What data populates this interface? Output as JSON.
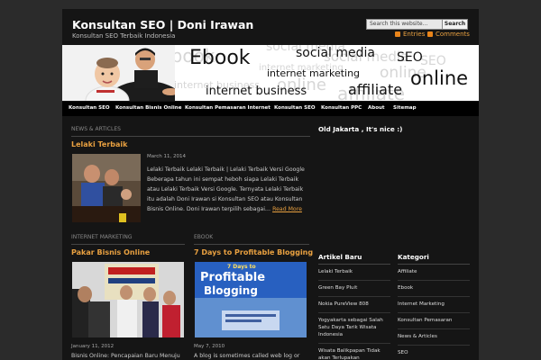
{
  "header": {
    "site_title": "Konsultan SEO | Doni Irawan",
    "tagline": "Konsultan SEO Terbaik Indonesia",
    "search_placeholder": "Search this website...",
    "search_button": "Search",
    "feed_entries": "Entries",
    "feed_comments": "Comments"
  },
  "banner": {
    "keywords": [
      "Ebook",
      "social media",
      "SEO",
      "internet marketing",
      "online",
      "internet business",
      "affiliate"
    ],
    "ghost_words": [
      "Ebook",
      "social media",
      "social media",
      "internet marketing",
      "online",
      "online",
      "internet business",
      "affiliate",
      "SEO"
    ]
  },
  "nav": {
    "items": [
      "Konsultan SEO",
      "Konsultan Bisnis Online",
      "Konsultan Pemasaran Internet",
      "Konsultan SEO",
      "Konsultan PPC",
      "About",
      "Sitemap"
    ]
  },
  "featured": {
    "section": "NEWS & ARTICLES",
    "title": "Lelaki Terbaik",
    "date": "March 11, 2014",
    "excerpt": "Lelaki Terbaik Lelaki Terbaik | Lelaki Terbaik Versi Google Beberapa tahun ini sempat heboh siapa Lelaki Terbaik atau Lelaki Terbaik Versi Google.  Ternyata Lelaki Terbaik itu adalah Doni Irawan si Konsultan SEO atau Konsultan Bisnis Online.  Doni Irawan terpilih sebagai…",
    "read_more": "Read More"
  },
  "col_left": {
    "section": "INTERNET MARKETING",
    "title": "Pakar Bisnis Online",
    "date": "January 11, 2012",
    "excerpt": "Bisnis Online: Pencapaian Baru Menuju Keuntungan Yang Tidak Terbatas Anda"
  },
  "col_right": {
    "section": "EBOOK",
    "title": "7 Days to Profitable Blogging",
    "date": "May 7, 2010",
    "excerpt": "A blog is sometimes called web log or weblog. At first, they were used as a",
    "thumb_line1": "7 Days to",
    "thumb_line2": "Profitable",
    "thumb_line3": "Blogging"
  },
  "sidebar": {
    "top_title": "Old Jakarta , It's nice :)",
    "artikel_title": "Artikel Baru",
    "artikel_items": [
      "Lelaki Terbaik",
      "Green Bay Pluit",
      "Nokia PureView 808",
      "Yogyakarta sebagai Salah Satu Daya Tarik Wisata Indonesia",
      "Wisata Balikpapan Tidak akan Terlupakan"
    ],
    "kategori_title": "Kategori",
    "kategori_items": [
      "Affiliate",
      "Ebook",
      "Internet Marketing",
      "Konsultan Pemasaran",
      "News & Articles",
      "SEO"
    ]
  },
  "colors": {
    "accent": "#e8a040",
    "background": "#151515",
    "page_bg": "#2b2b2b",
    "nav_bg": "#000000"
  }
}
